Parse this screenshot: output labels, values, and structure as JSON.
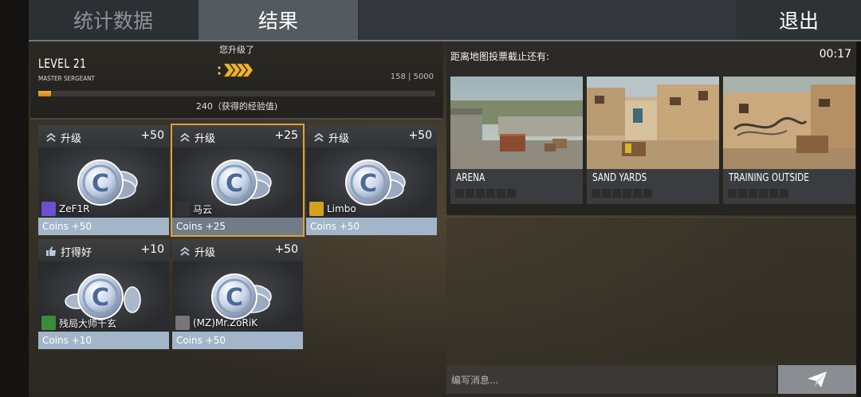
{
  "tabs": {
    "stats": "统计数据",
    "results": "结果",
    "exit": "退出"
  },
  "level": {
    "upgraded_label": "您升级了",
    "level_text": "LEVEL 21",
    "rank": "MASTER SERGEANT",
    "xp_progress": "158 | 5000",
    "xp_fraction": 0.032,
    "xp_gained_text": "240（获得的经验值)"
  },
  "cards": [
    {
      "title": "升级",
      "points": "+50",
      "player": "ZeF1R",
      "footer": "Coins +50",
      "icon": "double-chevron-up-icon",
      "selected": false
    },
    {
      "title": "升级",
      "points": "+25",
      "player": "马云",
      "footer": "Coins +25",
      "icon": "double-chevron-up-icon",
      "selected": true
    },
    {
      "title": "升级",
      "points": "+50",
      "player": "Limbo",
      "footer": "Coins +50",
      "icon": "double-chevron-up-icon",
      "selected": false
    },
    {
      "title": "打得好",
      "points": "+10",
      "player": "残局大师千玄",
      "footer": "Coins +10",
      "icon": "thumbs-up-icon",
      "selected": false
    },
    {
      "title": "升级",
      "points": "+50",
      "player": "(MZ)Mr.ZoRiK",
      "footer": "Coins +50",
      "icon": "double-chevron-up-icon",
      "selected": false
    }
  ],
  "map_vote": {
    "label": "距离地图投票截止还有:",
    "timer": "00:17",
    "maps": [
      {
        "name": "ARENA",
        "votes": 0,
        "slots": 6
      },
      {
        "name": "SAND YARDS",
        "votes": 0,
        "slots": 6
      },
      {
        "name": "TRAINING OUTSIDE",
        "votes": 0,
        "slots": 6
      }
    ]
  },
  "chat": {
    "placeholder": "编写消息..."
  },
  "colors": {
    "accent_gold": "#e0a13a",
    "footer_blue": "#a3b6c9",
    "xp_fill": "#f4b23c"
  }
}
